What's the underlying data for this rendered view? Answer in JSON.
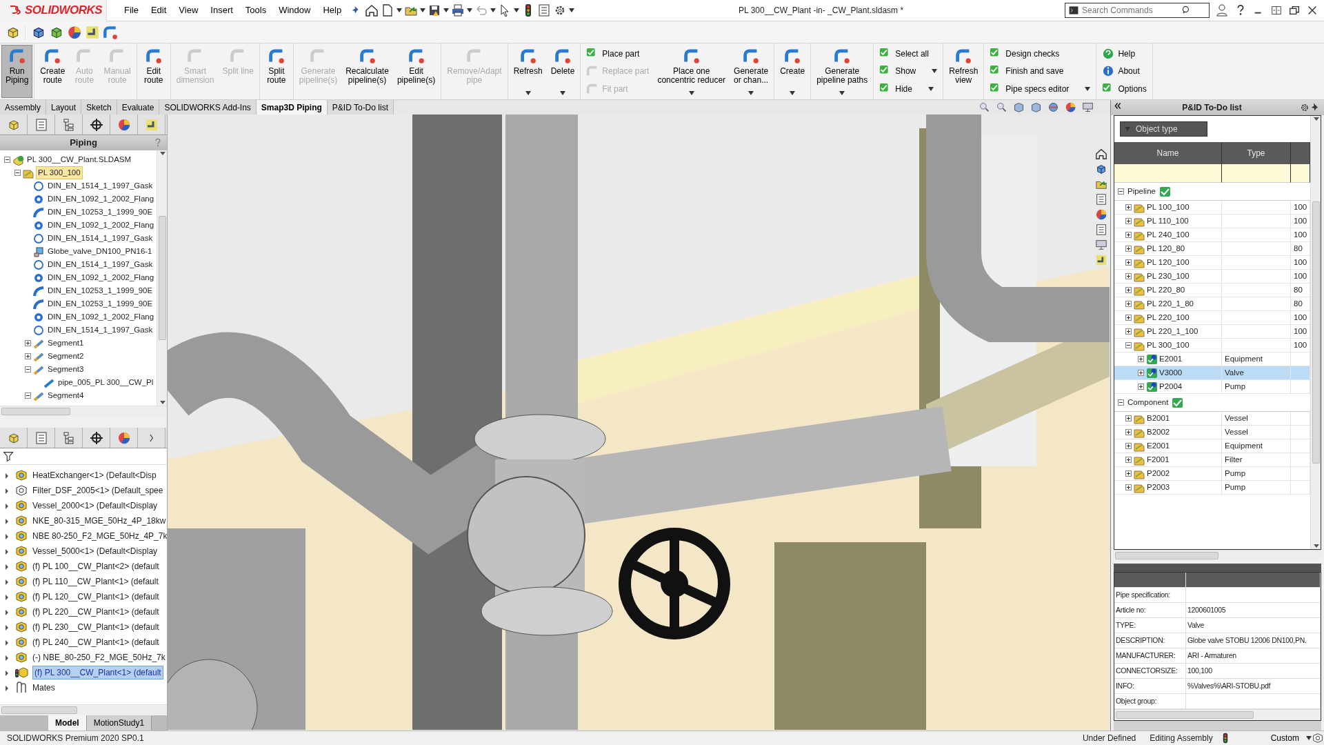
{
  "app": {
    "logo": "SOLIDWORKS",
    "menu": [
      "File",
      "Edit",
      "View",
      "Insert",
      "Tools",
      "Window",
      "Help"
    ],
    "title": "PL 300__CW_Plant -in- _CW_Plant.sldasm *",
    "search": {
      "placeholder": "Search Commands"
    }
  },
  "ribbon": {
    "groups": [
      [
        {
          "kind": "large",
          "label": "Run\nPiping",
          "pressed": true,
          "disabled": false,
          "has_menu": false
        }
      ],
      [
        {
          "kind": "large",
          "label": "Create\nroute",
          "pressed": false,
          "disabled": false,
          "has_menu": false
        },
        {
          "kind": "large",
          "label": "Auto\nroute",
          "pressed": false,
          "disabled": true,
          "has_menu": false
        },
        {
          "kind": "large",
          "label": "Manual\nroute",
          "pressed": false,
          "disabled": true,
          "has_menu": false
        }
      ],
      [
        {
          "kind": "large",
          "label": "Edit\nroute",
          "pressed": false,
          "disabled": false,
          "has_menu": false
        }
      ],
      [
        {
          "kind": "large",
          "label": "Smart\ndimension",
          "pressed": false,
          "disabled": true,
          "has_menu": false
        },
        {
          "kind": "large",
          "label": "Split line",
          "pressed": false,
          "disabled": true,
          "has_menu": false
        }
      ],
      [
        {
          "kind": "large",
          "label": "Split\nroute",
          "pressed": false,
          "disabled": false,
          "has_menu": false
        }
      ],
      [
        {
          "kind": "large",
          "label": "Generate\npipeline(s)",
          "pressed": false,
          "disabled": true,
          "has_menu": false
        },
        {
          "kind": "large",
          "label": "Recalculate\npipeline(s)",
          "pressed": false,
          "disabled": false,
          "has_menu": false
        },
        {
          "kind": "large",
          "label": "Edit\npipeline(s)",
          "pressed": false,
          "disabled": false,
          "has_menu": false
        }
      ],
      [
        {
          "kind": "large",
          "label": "Remove/Adapt\npipe",
          "pressed": false,
          "disabled": true,
          "has_menu": false
        }
      ],
      [
        {
          "kind": "large",
          "label": "Refresh",
          "pressed": false,
          "disabled": false,
          "has_menu": true
        },
        {
          "kind": "large",
          "label": "Delete",
          "pressed": false,
          "disabled": false,
          "has_menu": true
        }
      ],
      [
        {
          "kind": "stack",
          "items": [
            {
              "label": "Place part",
              "disabled": false,
              "has_menu": false
            },
            {
              "label": "Replace part",
              "disabled": true,
              "has_menu": false
            },
            {
              "label": "Fit part",
              "disabled": true,
              "has_menu": false
            }
          ]
        },
        {
          "kind": "large",
          "label": "Place one\nconcentric reducer",
          "pressed": false,
          "disabled": false,
          "has_menu": true
        },
        {
          "kind": "large",
          "label": "Generate\nor chan...",
          "pressed": false,
          "disabled": false,
          "has_menu": true
        }
      ],
      [
        {
          "kind": "large",
          "label": "Create",
          "pressed": false,
          "disabled": false,
          "has_menu": true
        }
      ],
      [
        {
          "kind": "large",
          "label": "Generate\npipeline paths",
          "pressed": false,
          "disabled": false,
          "has_menu": true
        }
      ],
      [
        {
          "kind": "stack",
          "items": [
            {
              "label": "Select all",
              "disabled": false,
              "has_menu": false
            },
            {
              "label": "Show",
              "disabled": false,
              "has_menu": true
            },
            {
              "label": "Hide",
              "disabled": false,
              "has_menu": true
            }
          ]
        }
      ],
      [
        {
          "kind": "large",
          "label": "Refresh\nview",
          "pressed": false,
          "disabled": false,
          "has_menu": false
        }
      ],
      [
        {
          "kind": "stack",
          "items": [
            {
              "label": "Design checks",
              "disabled": false,
              "has_menu": false
            },
            {
              "label": "Finish and save",
              "disabled": false,
              "has_menu": false
            },
            {
              "label": "Pipe specs editor",
              "disabled": false,
              "has_menu": true
            }
          ]
        }
      ],
      [
        {
          "kind": "stack",
          "items": [
            {
              "label": "Help",
              "disabled": false,
              "has_menu": false
            },
            {
              "label": "About",
              "disabled": false,
              "has_menu": false
            },
            {
              "label": "Options",
              "disabled": false,
              "has_menu": false
            }
          ]
        }
      ]
    ]
  },
  "tabs": [
    {
      "label": "Assembly",
      "selected": false
    },
    {
      "label": "Layout",
      "selected": false
    },
    {
      "label": "Sketch",
      "selected": false
    },
    {
      "label": "Evaluate",
      "selected": false
    },
    {
      "label": "SOLIDWORKS Add-Ins",
      "selected": false
    },
    {
      "label": "Smap3D Piping",
      "selected": true
    },
    {
      "label": "P&ID To-Do list",
      "selected": false
    }
  ],
  "piping_panel": {
    "title": "Piping",
    "tree": [
      {
        "label": "PL 300__CW_Plant.SLDASM",
        "kind": "assembly",
        "expanded": true,
        "selected": false,
        "children": [
          {
            "label": "PL 300_100",
            "kind": "pipeline",
            "expanded": true,
            "selected": true,
            "children": [
              {
                "label": "DIN_EN_1514_1_1997_Gask",
                "kind": "gasket",
                "selected": false
              },
              {
                "label": "DIN_EN_1092_1_2002_Flang",
                "kind": "flange",
                "selected": false
              },
              {
                "label": "DIN_EN_10253_1_1999_90E",
                "kind": "elbow",
                "selected": false
              },
              {
                "label": "DIN_EN_1092_1_2002_Flang",
                "kind": "flange",
                "selected": false
              },
              {
                "label": "DIN_EN_1514_1_1997_Gask",
                "kind": "gasket",
                "selected": false
              },
              {
                "label": "Globe_valve_DN100_PN16-1",
                "kind": "valve",
                "selected": false
              },
              {
                "label": "DIN_EN_1514_1_1997_Gask",
                "kind": "gasket",
                "selected": false
              },
              {
                "label": "DIN_EN_1092_1_2002_Flang",
                "kind": "flange",
                "selected": false
              },
              {
                "label": "DIN_EN_10253_1_1999_90E",
                "kind": "elbow",
                "selected": false
              },
              {
                "label": "DIN_EN_10253_1_1999_90E",
                "kind": "elbow",
                "selected": false
              },
              {
                "label": "DIN_EN_1092_1_2002_Flang",
                "kind": "flange",
                "selected": false
              },
              {
                "label": "DIN_EN_1514_1_1997_Gask",
                "kind": "gasket",
                "selected": false
              },
              {
                "label": "Segment1",
                "kind": "segment",
                "expanded": false,
                "selected": false
              },
              {
                "label": "Segment2",
                "kind": "segment",
                "expanded": false,
                "selected": false
              },
              {
                "label": "Segment3",
                "kind": "segment",
                "expanded": true,
                "selected": false,
                "children": [
                  {
                    "label": "pipe_005_PL 300__CW_Pl",
                    "kind": "pipe",
                    "selected": false
                  }
                ]
              },
              {
                "label": "Segment4",
                "kind": "segment",
                "expanded": true,
                "selected": false
              }
            ]
          }
        ]
      }
    ]
  },
  "feature_tree": {
    "items": [
      {
        "label": "HeatExchanger<1> (Default<Disp",
        "kind": "part",
        "selected": false
      },
      {
        "label": "Filter_DSF_2005<1> (Default_spee",
        "kind": "part-outline",
        "selected": false
      },
      {
        "label": "Vessel_2000<1> (Default<Display",
        "kind": "part",
        "selected": false
      },
      {
        "label": "NKE_80-315_MGE_50Hz_4P_18kw",
        "kind": "part",
        "selected": false
      },
      {
        "label": "NBE 80-250_F2_MGE_50Hz_4P_7k",
        "kind": "part",
        "selected": false
      },
      {
        "label": "Vessel_5000<1> (Default<Display",
        "kind": "part",
        "selected": false
      },
      {
        "label": "(f) PL 100__CW_Plant<2> (default",
        "kind": "part",
        "selected": false
      },
      {
        "label": "(f) PL 110__CW_Plant<1> (default",
        "kind": "part",
        "selected": false
      },
      {
        "label": "(f) PL 120__CW_Plant<1> (default",
        "kind": "part",
        "selected": false
      },
      {
        "label": "(f) PL 220__CW_Plant<1> (default",
        "kind": "part",
        "selected": false
      },
      {
        "label": "(f) PL 230__CW_Plant<1> (default",
        "kind": "part",
        "selected": false
      },
      {
        "label": "(f) PL 240__CW_Plant<1> (default",
        "kind": "part",
        "selected": false
      },
      {
        "label": "(-) NBE_80-250_F2_MGE_50Hz_7k",
        "kind": "part",
        "selected": false
      },
      {
        "label": "(f) PL 300__CW_Plant<1> (default",
        "kind": "part-editing",
        "selected": true
      },
      {
        "label": "Mates",
        "kind": "mates",
        "selected": false
      }
    ],
    "bottom_tabs": [
      {
        "label": "Model",
        "selected": true
      },
      {
        "label": "MotionStudy1",
        "selected": false
      }
    ]
  },
  "todo_panel": {
    "title": "P&ID To-Do list",
    "filter": "Object type",
    "columns": [
      "Name",
      "Type"
    ],
    "groups": [
      {
        "label": "Pipeline",
        "checked": true,
        "rows": [
          {
            "name": "PL 100_100",
            "size": "100",
            "expanded": false,
            "selected": false
          },
          {
            "name": "PL 110_100",
            "size": "100",
            "expanded": false,
            "selected": false
          },
          {
            "name": "PL 240_100",
            "size": "100",
            "expanded": false,
            "selected": false
          },
          {
            "name": "PL 120_80",
            "size": "80",
            "expanded": false,
            "selected": false
          },
          {
            "name": "PL 120_100",
            "size": "100",
            "expanded": false,
            "selected": false
          },
          {
            "name": "PL 230_100",
            "size": "100",
            "expanded": false,
            "selected": false
          },
          {
            "name": "PL 220_80",
            "size": "80",
            "expanded": false,
            "selected": false
          },
          {
            "name": "PL 220_1_80",
            "size": "80",
            "expanded": false,
            "selected": false
          },
          {
            "name": "PL 220_100",
            "size": "100",
            "expanded": false,
            "selected": false
          },
          {
            "name": "PL 220_1_100",
            "size": "100",
            "expanded": false,
            "selected": false
          },
          {
            "name": "PL 300_100",
            "size": "100",
            "expanded": true,
            "selected": false,
            "children": [
              {
                "name": "E2001",
                "type": "Equipment",
                "expanded": false,
                "selected": false
              },
              {
                "name": "V3000",
                "type": "Valve",
                "expanded": false,
                "selected": true
              },
              {
                "name": "P2004",
                "type": "Pump",
                "expanded": false,
                "selected": false
              }
            ]
          }
        ]
      },
      {
        "label": "Component",
        "checked": true,
        "rows": [
          {
            "name": "B2001",
            "type": "Vessel",
            "expanded": false,
            "selected": false
          },
          {
            "name": "B2002",
            "type": "Vessel",
            "expanded": false,
            "selected": false
          },
          {
            "name": "E2001",
            "type": "Equipment",
            "expanded": false,
            "selected": false
          },
          {
            "name": "F2001",
            "type": "Filter",
            "expanded": false,
            "selected": false
          },
          {
            "name": "P2002",
            "type": "Pump",
            "expanded": false,
            "selected": false
          },
          {
            "name": "P2003",
            "type": "Pump",
            "expanded": false,
            "selected": false
          }
        ]
      }
    ],
    "properties": [
      {
        "label": "Pipe specification:"
      },
      {
        "label": "Article no:",
        "value": "1200601005"
      },
      {
        "label": "TYPE:",
        "value": "Valve"
      },
      {
        "label": "DESCRIPTION:",
        "value": "Globe valve STOBU 12006 DN100,PN."
      },
      {
        "label": "MANUFACTURER:",
        "value": "ARI - Armaturen"
      },
      {
        "label": "CONNECTORSIZE:",
        "value": "100,100"
      },
      {
        "label": "INFO:",
        "value": "%Valves%\\ARI-STOBU.pdf"
      },
      {
        "label": "Object group:"
      }
    ]
  },
  "status_bar": {
    "product": "SOLIDWORKS Premium 2020 SP0.1",
    "state": "Under Defined",
    "mode": "Editing Assembly",
    "units": "Custom"
  }
}
